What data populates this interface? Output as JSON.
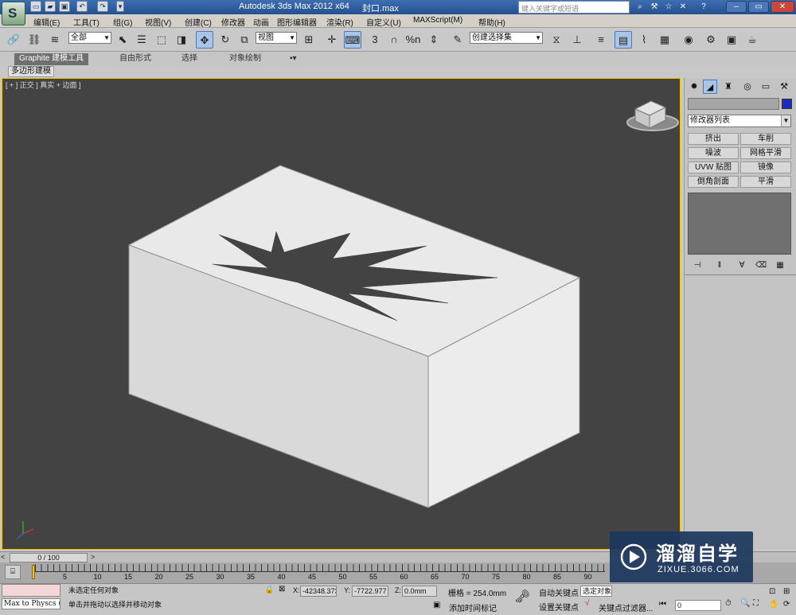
{
  "window": {
    "title": "Autodesk 3ds Max  2012 x64",
    "file": "封口.max",
    "search_placeholder": "键入关键字或短语",
    "logo_letter": "S"
  },
  "menu": {
    "items": [
      "编辑(E)",
      "工具(T)",
      "组(G)",
      "视图(V)",
      "创建(C)",
      "修改器",
      "动画",
      "图形编辑器",
      "渲染(R)",
      "自定义(U)",
      "MAXScript(M)",
      "帮助(H)"
    ]
  },
  "toolbar": {
    "selection_filter": "全部",
    "reference_coord": "视图",
    "named_selection_set": "创建选择集",
    "snap_3": "3",
    "percent_snap": "%n",
    "abc_label": "ABC"
  },
  "ribbon": {
    "tabs": [
      "Graphite 建模工具",
      "自由形式",
      "选择",
      "对象绘制"
    ],
    "subtab": "多边形建模"
  },
  "viewport": {
    "label": "[ + ] 正交 ] 真实 + 边面 ]",
    "border_color": "#f2c200",
    "background": "#434343"
  },
  "command_panel": {
    "modifier_list": "修改器列表",
    "modifier_buttons": [
      "挤出",
      "车削",
      "噪波",
      "网格平滑",
      "UVW 贴图",
      "镜像",
      "倒角剖面",
      "平滑"
    ],
    "object_color": "#1b2cc2"
  },
  "timeline": {
    "frame_display": "0 / 100",
    "ticks": [
      "5",
      "10",
      "15",
      "20",
      "25",
      "30",
      "35",
      "40",
      "45",
      "50",
      "55",
      "60",
      "65",
      "70",
      "75",
      "80",
      "85",
      "90"
    ]
  },
  "status": {
    "maxscript_listener": "Max to Physcs (",
    "selection_status": "未选定任何对象",
    "prompt": "单击并拖动以选择并移动对象",
    "x_label": "X:",
    "x_value": "-42348.373",
    "y_label": "Y:",
    "y_value": "-7722.977",
    "z_label": "Z:",
    "z_value": "0.0mm",
    "grid": "栅格 = 254.0mm",
    "add_time_tag": "添加时间标记",
    "auto_key": "自动关键点",
    "selected": "选定对象",
    "set_key": "设置关键点",
    "key_filters": "关键点过滤器...",
    "current_frame": "0"
  },
  "watermark": {
    "brand": "溜溜自学",
    "url": "ZIXUE.3066.COM"
  }
}
